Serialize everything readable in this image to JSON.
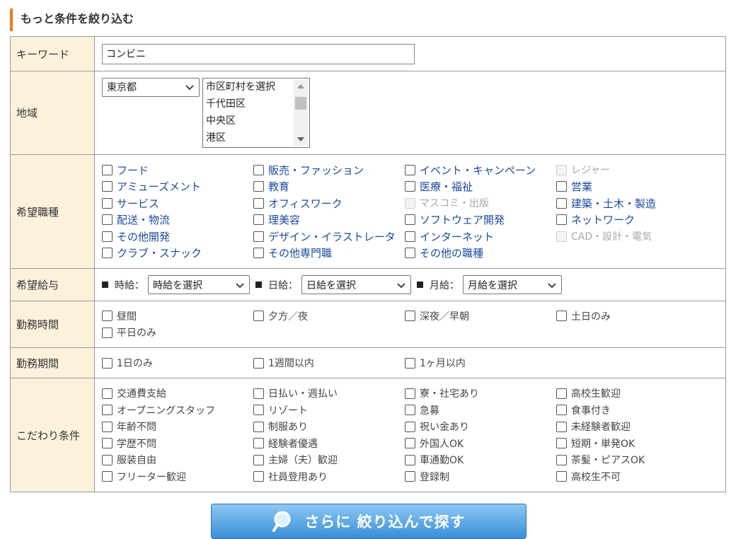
{
  "section_title": "もっと条件を絞り込む",
  "labels": {
    "keyword": "キーワード",
    "area": "地域",
    "job": "希望職種",
    "salary": "希望給与",
    "time": "勤務時間",
    "period": "勤務期間",
    "extra": "こだわり条件"
  },
  "keyword": {
    "value": "コンビニ"
  },
  "area": {
    "prefecture": "東京都",
    "cities": [
      "市区町村を選択",
      "千代田区",
      "中央区",
      "港区"
    ]
  },
  "jobs": [
    {
      "label": "フード",
      "disabled": false
    },
    {
      "label": "販売・ファッション",
      "disabled": false
    },
    {
      "label": "イベント・キャンペーン",
      "disabled": false
    },
    {
      "label": "レジャー",
      "disabled": true
    },
    {
      "label": "アミューズメント",
      "disabled": false
    },
    {
      "label": "教育",
      "disabled": false
    },
    {
      "label": "医療・福祉",
      "disabled": false
    },
    {
      "label": "営業",
      "disabled": false
    },
    {
      "label": "サービス",
      "disabled": false
    },
    {
      "label": "オフィスワーク",
      "disabled": false
    },
    {
      "label": "マスコミ・出版",
      "disabled": true
    },
    {
      "label": "建築・土木・製造",
      "disabled": false
    },
    {
      "label": "配送・物流",
      "disabled": false
    },
    {
      "label": "理美容",
      "disabled": false
    },
    {
      "label": "ソフトウェア開発",
      "disabled": false
    },
    {
      "label": "ネットワーク",
      "disabled": false
    },
    {
      "label": "その他開発",
      "disabled": false
    },
    {
      "label": "デザイン・イラストレータ",
      "disabled": false
    },
    {
      "label": "インターネット",
      "disabled": false
    },
    {
      "label": "CAD・設計・電気",
      "disabled": true
    },
    {
      "label": "クラブ・スナック",
      "disabled": false
    },
    {
      "label": "その他専門職",
      "disabled": false
    },
    {
      "label": "その他の職種",
      "disabled": false
    }
  ],
  "salary": {
    "hourly_label": "時給：",
    "hourly_select": "時給を選択",
    "daily_label": "日給：",
    "daily_select": "日給を選択",
    "monthly_label": "月給：",
    "monthly_select": "月給を選択"
  },
  "work_time": [
    "昼間",
    "夕方／夜",
    "深夜／早朝",
    "土日のみ",
    "平日のみ"
  ],
  "work_period": [
    "1日のみ",
    "1週間以内",
    "1ヶ月以内"
  ],
  "extras": [
    "交通費支給",
    "日払い・週払い",
    "寮・社宅あり",
    "高校生歓迎",
    "オープニングスタッフ",
    "リゾート",
    "急募",
    "食事付き",
    "年齢不問",
    "制服あり",
    "祝い金あり",
    "未経験者歓迎",
    "学歴不問",
    "経験者優遇",
    "外国人OK",
    "短期・単発OK",
    "服装自由",
    "主婦（夫）歓迎",
    "車通勤OK",
    "茶髪・ピアスOK",
    "フリーター歓迎",
    "社員登用あり",
    "登録制",
    "高校生不可"
  ],
  "search_button": {
    "label": "さらに 絞り込んで探す"
  },
  "colors": {
    "accent": "#e67e22",
    "header_bg": "#fdf1dc",
    "link": "#1a4a9c",
    "button": "#3a8ed8"
  }
}
